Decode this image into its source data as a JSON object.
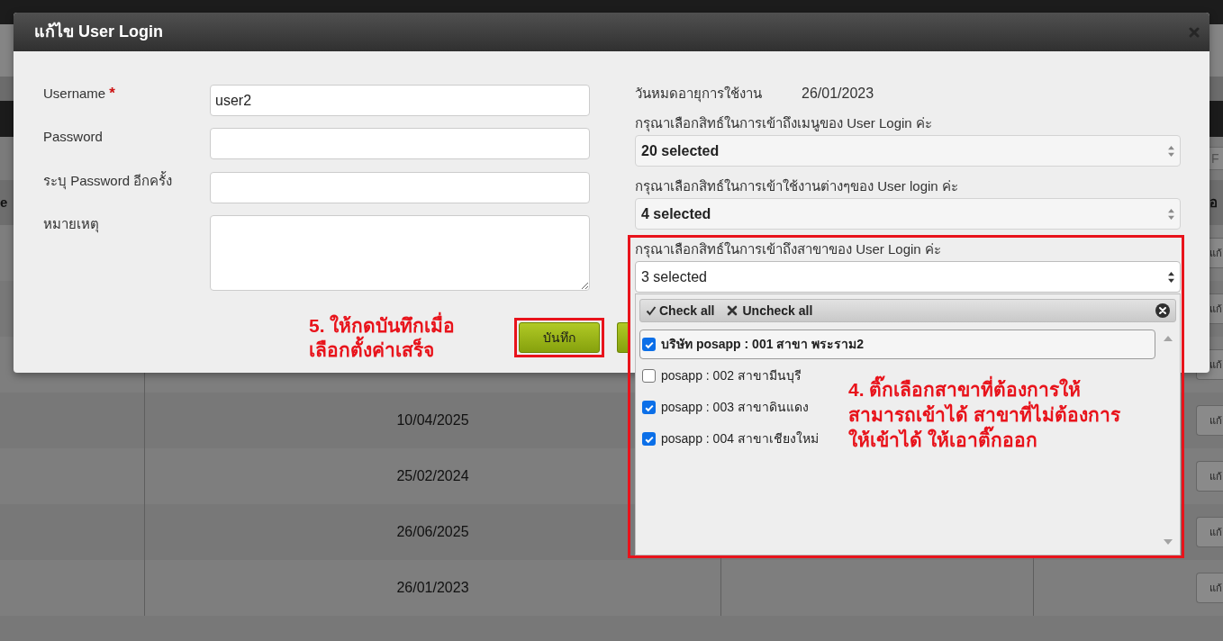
{
  "page": {
    "search": {
      "placeholder": "F"
    }
  },
  "table": {
    "header": {
      "column_1": "e",
      "column_4": "อ"
    },
    "rows": [
      {
        "action": "แก้"
      },
      {
        "action": "แก้"
      },
      {
        "action": "แก้"
      },
      {
        "date": "10/04/2025",
        "action": "แก้"
      },
      {
        "date": "25/02/2024",
        "action": "แก้"
      },
      {
        "date": "26/06/2025",
        "action": "แก้"
      },
      {
        "date": "26/01/2023",
        "action": "แก้"
      }
    ]
  },
  "dialog": {
    "title": "แก้ไข User Login",
    "fields": [
      {
        "kind": "text",
        "label": "Username",
        "required_mark": "*",
        "value": "user2"
      },
      {
        "kind": "password",
        "label": "Password"
      },
      {
        "kind": "password",
        "label": "ระบุ Password อีกครั้ง"
      },
      {
        "kind": "textarea",
        "label": "หมายเหตุ"
      }
    ],
    "expiry": {
      "label": "วันหมดอายุการใช้งาน",
      "value": "26/01/2023"
    },
    "permissions": [
      {
        "label": "กรุณาเลือกสิทธ์ในการเข้าถึงเมนูของ User Login ค่ะ",
        "value": "20 selected",
        "open": false
      },
      {
        "label": "กรุณาเลือกสิทธ์ในการเข้าใช้งานต่างๆของ User login ค่ะ",
        "value": "4 selected",
        "open": false
      },
      {
        "label": "กรุณาเลือกสิทธ์ในการเข้าถึงสาขาของ User Login ค่ะ",
        "value": "3 selected",
        "open": true,
        "highlighted": true,
        "menu": {
          "check_all": "Check all",
          "uncheck_all": "Uncheck all",
          "items": [
            {
              "label": "บริษัท posapp : 001 สาขา พระราม2",
              "checked": true,
              "focused": true
            },
            {
              "label": "posapp : 002 สาขามีนบุรี",
              "checked": false,
              "focused": false
            },
            {
              "label": "posapp : 003 สาขาดินแดง",
              "checked": true,
              "focused": false
            },
            {
              "label": "posapp : 004 สาขาเชียงใหม่",
              "checked": true,
              "focused": false
            }
          ]
        }
      }
    ],
    "save_button": {
      "label": "บันทึก",
      "highlighted": true
    }
  },
  "annotations": {
    "save_note": "5. ให้กดบันทึกเมื่อ\nเลือกตั้งค่าเสร็จ",
    "branch_note": "4. ติ๊กเลือกสาขาที่ต้องการให้\nสามารถเข้าได้ สาขาที่ไม่ต้องการ\nให้เข้าได้ ให้เอาติ๊กออก"
  }
}
